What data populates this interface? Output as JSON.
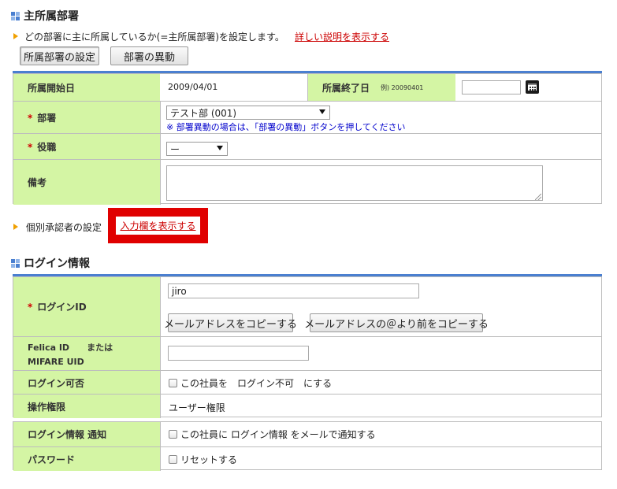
{
  "section1": {
    "title": "主所属部署",
    "description": "どの部署に主に所属しているか(=主所属部署)を設定します。",
    "detail_link": "詳しい説明を表示する",
    "tab_main": "所属部署の設定",
    "tab_transfer": "部署の異動",
    "start_date_label": "所属開始日",
    "start_date_value": "2009/04/01",
    "end_date_label": "所属終了日",
    "end_date_example": "例) 20090401",
    "end_date_value": "",
    "dept_label": "部署",
    "dept_value": "テスト部 (001)",
    "dept_note": "※ 部署異動の場合は、「部署の異動」ボタンを押してください",
    "position_label": "役職",
    "position_value": "ー",
    "remarks_label": "備考",
    "remarks_value": "",
    "required_mark": "*"
  },
  "approver": {
    "label": "個別承認者の設定",
    "link": "入力欄を表示する"
  },
  "section2": {
    "title": "ログイン情報",
    "login_id_label": "ログインID",
    "login_id_value": "jiro",
    "copy_email_btn": "メールアドレスをコピーする",
    "copy_before_at_btn": "メールアドレスの＠より前をコピーする",
    "felica_label_1": "Felica ID　　または",
    "felica_label_2": "MIFARE UID",
    "felica_value": "",
    "login_allow_label": "ログイン可否",
    "login_allow_text": "この社員を　ログイン不可　にする",
    "permission_label": "操作権限",
    "permission_value": "ユーザー権限",
    "notify_label": "ログイン情報 通知",
    "notify_text": "この社員に ログイン情報 をメールで通知する",
    "password_label": "パスワード",
    "password_text": "リセットする",
    "required_mark": "*"
  },
  "colors": {
    "label_bg": "#d4f5a4",
    "accent_blue": "#4a7fd0",
    "highlight_red": "#e00000",
    "arrow_orange": "#f0a000"
  }
}
